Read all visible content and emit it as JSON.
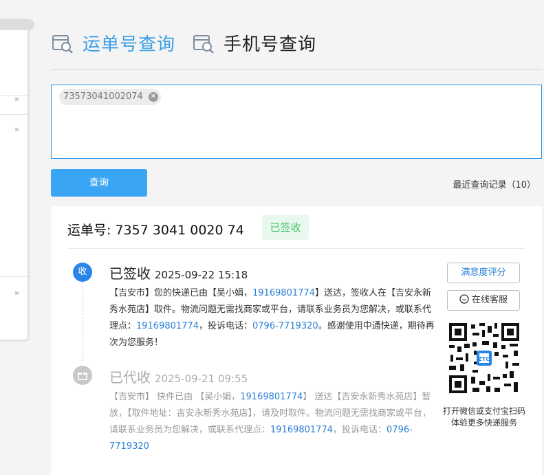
{
  "tabs": [
    {
      "label": "运单号查询",
      "active": true,
      "icon": "package-search-icon"
    },
    {
      "label": "手机号查询",
      "active": false,
      "icon": "package-search-icon"
    }
  ],
  "query": {
    "chip": "73573041002074",
    "button": "查询",
    "recent": "最近查询记录（10）"
  },
  "result": {
    "waybill": "运单号: 7357 3041 0020 74",
    "status_badge": "已签收",
    "buttons": {
      "rate": "满意度评分",
      "cs": "在线客服"
    },
    "qr_text": [
      "打开微信或支付宝扫码",
      "体验更多快递服务"
    ],
    "events": [
      {
        "node": "收",
        "title": "已签收",
        "time": "2025-09-22 15:18",
        "body": [
          {
            "t": "【吉安市】您的快递已由【吴小娟，"
          },
          {
            "t": "19169801774",
            "link": true
          },
          {
            "t": "】送达，签收人在【吉安永新秀水苑店】取件。物流问题无需找商家或平台，请联系业务员为您解决，或联系代理点："
          },
          {
            "t": "19169801774",
            "link": true
          },
          {
            "t": "，投诉电话："
          },
          {
            "t": "0796-7719320",
            "link": true
          },
          {
            "t": "。感谢使用中通快递，期待再次为您服务！"
          }
        ]
      },
      {
        "node": "gift-icon",
        "title": "已代收",
        "time": "2025-09-21 09:55",
        "body": [
          {
            "t": "【吉安市】 快件已由 【吴小娟，"
          },
          {
            "t": "19169801774",
            "link": true
          },
          {
            "t": "】 送达【吉安永新秀水苑店】暂放，【取件地址：吉安永新秀水苑店】，请及时取件。物流问题无需找商家或平台，请联系业务员为您解决，或联系代理点："
          },
          {
            "t": "19169801774",
            "link": true
          },
          {
            "t": "，投诉电话："
          },
          {
            "t": "0796-7719320",
            "link": true
          }
        ]
      }
    ]
  },
  "colors": {
    "accent": "#3b9ee6",
    "button": "#3aa5f5",
    "signed_badge_text": "#4cc26b",
    "link": "#2a7fd6"
  }
}
